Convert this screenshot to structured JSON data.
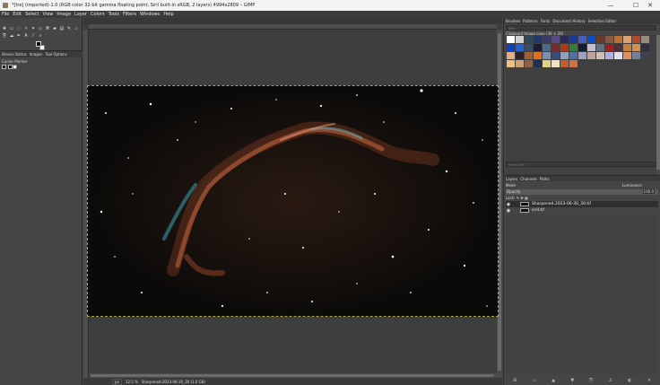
{
  "window": {
    "title": "*[tre] (imported)-1.0 (RGB color 32-bit gamma floating point, Siril built-in sRGB, 2 layers) 4994x2809 – GIMP",
    "minimize_icon": "minimize-icon",
    "maximize_icon": "maximize-icon",
    "close_icon": "close-icon"
  },
  "menu": [
    "File",
    "Edit",
    "Select",
    "View",
    "Image",
    "Layer",
    "Colors",
    "Tools",
    "Filters",
    "Windows",
    "Help"
  ],
  "left_dock": {
    "tabs": [
      "Device Status",
      "Images",
      "Tool Options"
    ],
    "panel_title": "Cursor Pointer"
  },
  "statusbar": {
    "unit": "px",
    "zoom": "12.5 %",
    "file": "Sharpened.2023-06-30_30 (1.0 GB)"
  },
  "right_dock": {
    "tabs": [
      "Brushes",
      "Patterns",
      "Fonts",
      "Document History",
      "Selection Editor"
    ],
    "filter_placeholder": "filter",
    "brush_label": "Clipboard Image copy (36 × 20)",
    "tag_placeholder": "enter tags",
    "brush_colors": [
      "#ffffff",
      "#d0d0d0",
      "#2c4a5a",
      "#1e3a70",
      "#3a3a6a",
      "#5a4a8a",
      "#2a2a5a",
      "#1a3a9a",
      "#4a5aba",
      "#0a50c0",
      "#6a3a2a",
      "#8a5a3a",
      "#c07030",
      "#e0a070",
      "#b04a2a",
      "#9a8a7a",
      "#1040c0",
      "#2060d0",
      "#3a4a6a",
      "#1a1a3a",
      "#4a6a8a",
      "#7a2a2a",
      "#aa3a1a",
      "#3a7a3a",
      "#102030",
      "#c0c0d0",
      "#607080",
      "#a02020",
      "#503030",
      "#c08040",
      "#d09050",
      "#303040",
      "#e0b080",
      "#302020",
      "#a06030",
      "#e07020",
      "#8090b0",
      "#3a4a7a",
      "#90a0c0",
      "#5070a0",
      "#a0a0c0",
      "#c0a0a0",
      "#d0c0b0",
      "#b0b0e0",
      "#e0e0f0",
      "#e09060",
      "#7080a0",
      "#404050",
      "#f0c080",
      "#d0a070",
      "#906040",
      "#203050",
      "#e0d080",
      "#f0e0c0",
      "#c06030",
      "#d07040"
    ],
    "layer_tabs": [
      "Layers",
      "Channels",
      "Paths"
    ],
    "mode_label": "Mode",
    "mode_value": "Luminance",
    "opacity_label": "Opacity",
    "opacity_value": "100.0",
    "lock_label": "Lock:",
    "layers": [
      {
        "name": "Sharpened.2023-06-30_30.tif",
        "selected": true
      },
      {
        "name": "siril.tif",
        "selected": false
      }
    ]
  }
}
